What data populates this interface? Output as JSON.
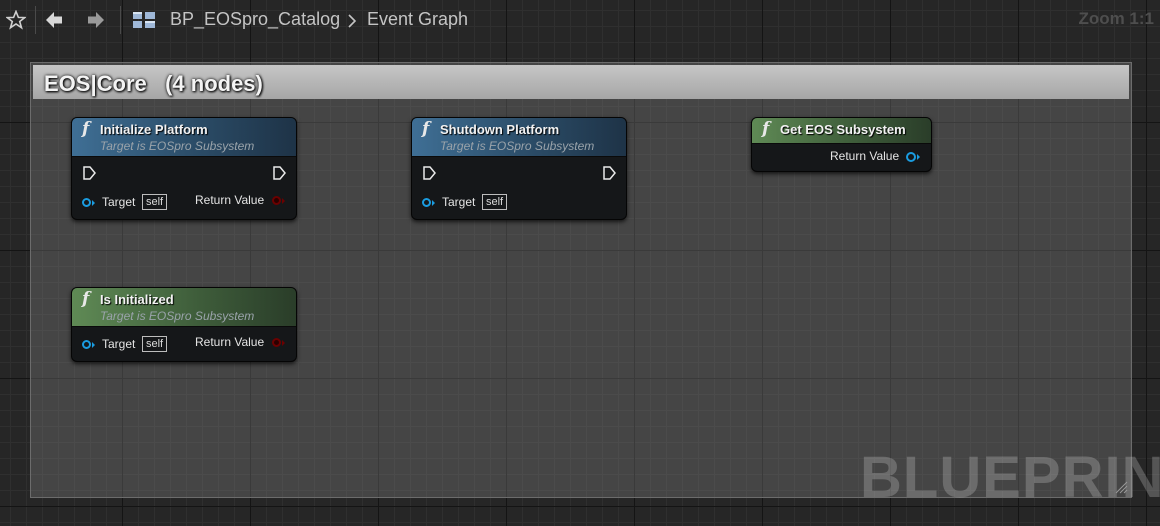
{
  "toolbar": {
    "favorite_icon": "star-icon",
    "back_icon": "arrow-left-icon",
    "forward_icon": "arrow-right-icon",
    "graph_icon": "blueprint-graph-icon",
    "breadcrumb": [
      "BP_EOSpro_Catalog",
      "Event Graph"
    ],
    "zoom": "Zoom 1:1"
  },
  "comment": {
    "title": "EOS|Core   (4 nodes)"
  },
  "nodes": {
    "initialize": {
      "title": "Initialize Platform",
      "subtitle": "Target is EOSpro Subsystem",
      "target_label": "Target",
      "self_label": "self",
      "return_label": "Return Value"
    },
    "shutdown": {
      "title": "Shutdown Platform",
      "subtitle": "Target is EOSpro Subsystem",
      "target_label": "Target",
      "self_label": "self"
    },
    "get_subsystem": {
      "title": "Get EOS Subsystem",
      "return_label": "Return Value"
    },
    "is_initialized": {
      "title": "Is Initialized",
      "subtitle": "Target is EOSpro Subsystem",
      "target_label": "Target",
      "self_label": "self",
      "return_label": "Return Value"
    }
  },
  "watermark": "BLUEPRINT",
  "colors": {
    "function_header": "#3f6f95",
    "pure_header": "#5f8a55",
    "object_pin": "#1a9ce0",
    "bool_pin": "#6b0000"
  }
}
